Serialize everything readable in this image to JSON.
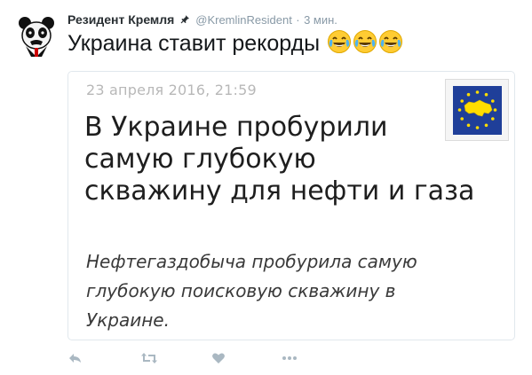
{
  "tweet": {
    "author_name": "Резидент Кремля",
    "handle": "@KremlinResident",
    "separator": "·",
    "time": "3 мин.",
    "text": "Украина ставит рекорды",
    "emoji_count": 3
  },
  "media": {
    "date": "23 апреля 2016, 21:59",
    "headline_lines": [
      "В Украине пробурили",
      "самую глубокую",
      "скважину для нефти и газа"
    ],
    "subtitle_lines": [
      "Нефтегаздобыча пробурила самую",
      "глубокую поисковую скважину в",
      "Украине."
    ]
  },
  "actions": {
    "reply_icon": "reply-icon",
    "retweet_icon": "retweet-icon",
    "like_icon": "heart-icon",
    "more_icon": "more-icon"
  },
  "colors": {
    "muted": "#8899a6",
    "text": "#14171a",
    "border": "#e1e8ed",
    "eu_blue": "#1f3f99",
    "eu_yellow": "#ffdd00"
  }
}
